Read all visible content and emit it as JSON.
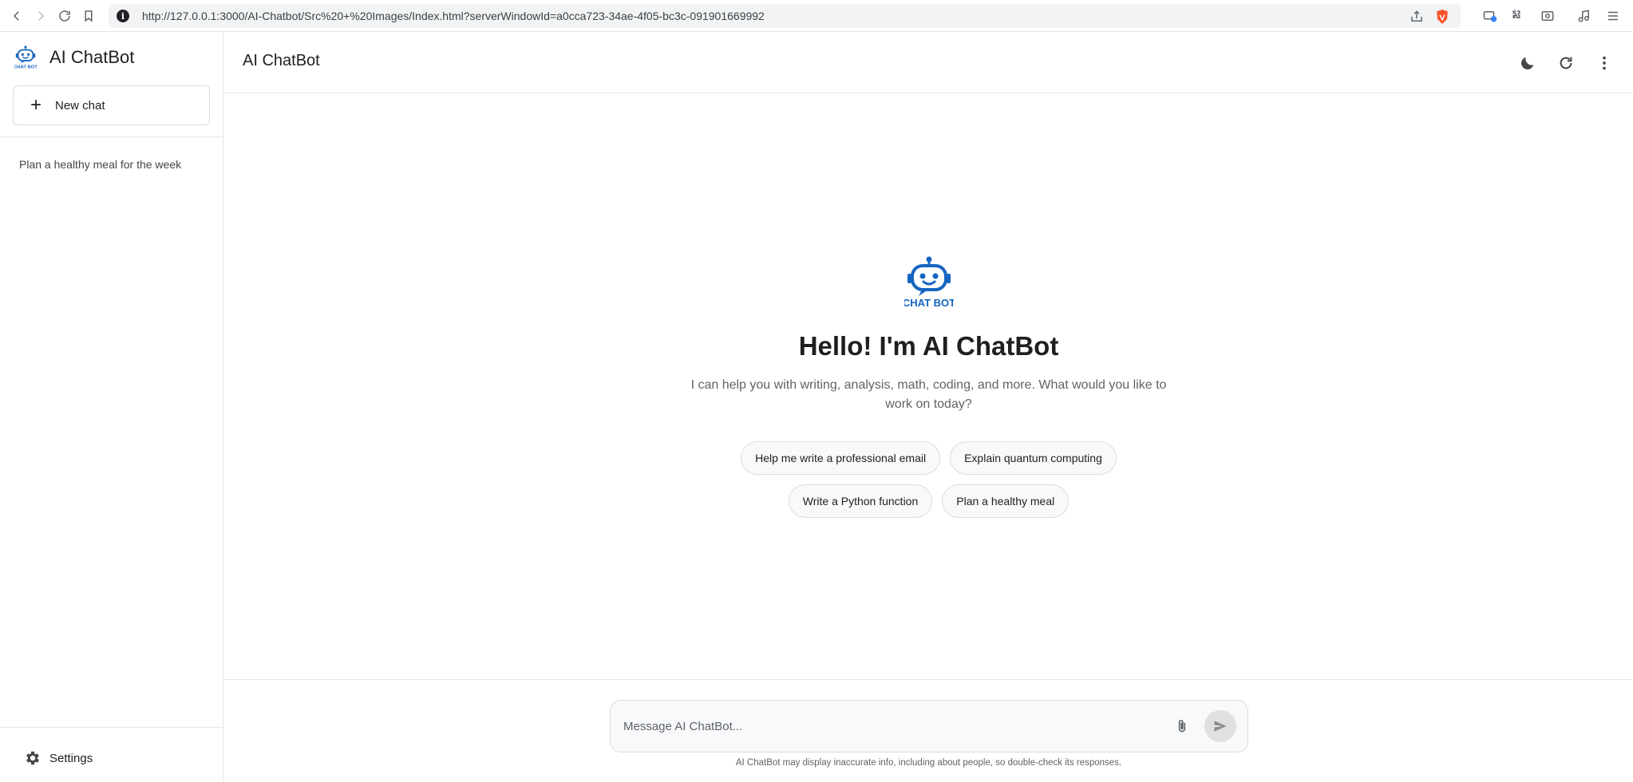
{
  "browser": {
    "url": "http://127.0.0.1:3000/AI-Chatbot/Src%20+%20Images/Index.html?serverWindowId=a0cca723-34ae-4f05-bc3c-091901669992",
    "icons": [
      "back-icon",
      "forward-icon",
      "reload-icon",
      "bookmark-icon",
      "site-info-icon",
      "share-icon",
      "brave-shield-icon",
      "wallet-icon",
      "extensions-icon",
      "sidebar-icon",
      "media-icon",
      "menu-icon"
    ]
  },
  "sidebar": {
    "brand_title": "AI ChatBot",
    "new_chat_label": "New chat",
    "history": [
      {
        "label": "Plan a healthy meal for the week"
      }
    ],
    "settings_label": "Settings"
  },
  "header": {
    "title": "AI ChatBot"
  },
  "welcome": {
    "logo_text": "CHAT BOT",
    "title": "Hello! I'm AI ChatBot",
    "subtitle": "I can help you with writing, analysis, math, coding, and more. What would you like to work on today?",
    "suggestions": [
      "Help me write a professional email",
      "Explain quantum computing",
      "Write a Python function",
      "Plan a healthy meal"
    ]
  },
  "composer": {
    "placeholder": "Message AI ChatBot...",
    "disclaimer": "AI ChatBot may display inaccurate info, including about people, so double-check its responses."
  },
  "colors": {
    "brand_blue": "#1565c0",
    "brave_orange": "#fb542b"
  }
}
